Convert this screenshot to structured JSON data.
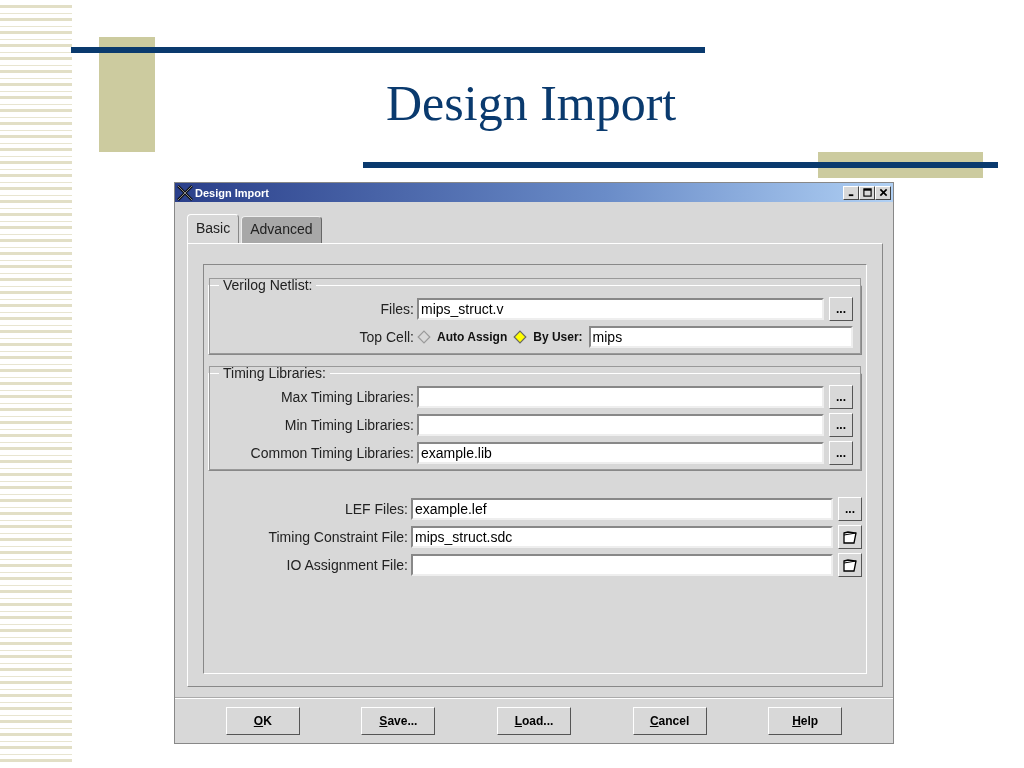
{
  "slide": {
    "title": "Design Import"
  },
  "dialog": {
    "title": "Design Import",
    "tabs": [
      {
        "label": "Basic",
        "selected": true
      },
      {
        "label": "Advanced",
        "selected": false
      }
    ],
    "verilog": {
      "legend": "Verilog Netlist:",
      "files": {
        "label": "Files:",
        "value": "mips_struct.v",
        "button": "..."
      },
      "top_cell": {
        "label": "Top Cell:",
        "options": [
          {
            "label": "Auto Assign",
            "selected": false
          },
          {
            "label": "By User:",
            "selected": true
          }
        ],
        "value": "mips"
      }
    },
    "timing": {
      "legend": "Timing Libraries:",
      "rows": [
        {
          "label": "Max Timing Libraries:",
          "button": "..."
        },
        {
          "label": "Min Timing Libraries:",
          "button": "..."
        },
        {
          "label": "Common Timing Libraries:",
          "value": "example.lib",
          "button": "..."
        }
      ]
    },
    "files": [
      {
        "label": "LEF Files:",
        "value": "example.lef",
        "kind": "browse",
        "button": "..."
      },
      {
        "label": "Timing Constraint File:",
        "value": "mips_struct.sdc",
        "kind": "folder"
      },
      {
        "label": "IO Assignment File:",
        "kind": "folder"
      }
    ],
    "buttons": [
      {
        "key": "O",
        "rest": "K"
      },
      {
        "key": "S",
        "rest": "ave..."
      },
      {
        "key": "L",
        "rest": "oad..."
      },
      {
        "key": "C",
        "rest": "ancel"
      },
      {
        "key": "H",
        "rest": "elp"
      }
    ]
  }
}
